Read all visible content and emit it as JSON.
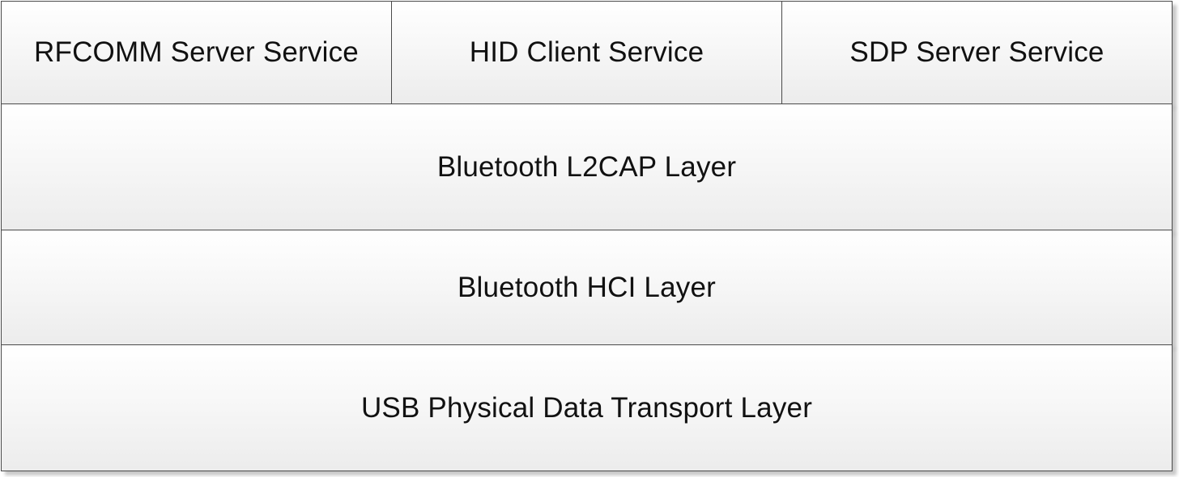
{
  "services": [
    {
      "label": "RFCOMM Server Service"
    },
    {
      "label": "HID Client Service"
    },
    {
      "label": "SDP Server Service"
    }
  ],
  "layers": [
    {
      "label": "Bluetooth L2CAP Layer"
    },
    {
      "label": "Bluetooth HCI Layer"
    },
    {
      "label": "USB Physical Data Transport Layer"
    }
  ],
  "colors": {
    "border": "#4a4a4a",
    "fill_top": "#ffffff",
    "fill_bottom": "#ececec",
    "text": "#111111"
  }
}
